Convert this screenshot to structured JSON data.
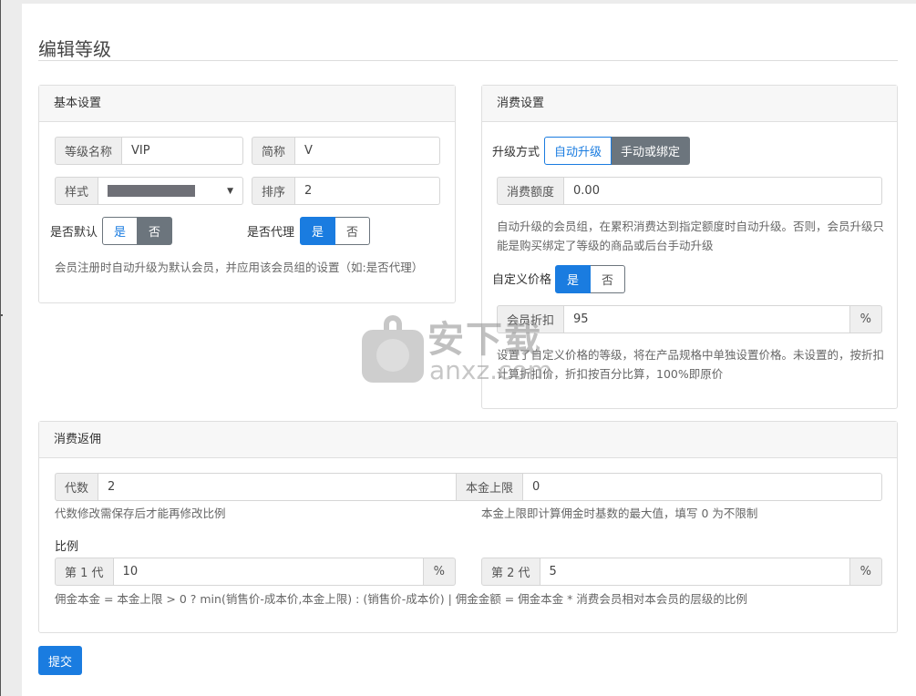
{
  "page": {
    "title": "编辑等级"
  },
  "basic": {
    "header": "基本设置",
    "level_name_label": "等级名称",
    "level_name_value": "VIP",
    "short_label": "简称",
    "short_value": "V",
    "style_label": "样式",
    "style_color": "#6f7077",
    "order_label": "排序",
    "order_value": "2",
    "default_label": "是否默认",
    "default_yes": "是",
    "default_no": "否",
    "default_selected": "否",
    "agent_label": "是否代理",
    "agent_yes": "是",
    "agent_no": "否",
    "agent_selected": "是",
    "help": "会员注册时自动升级为默认会员，并应用该会员组的设置（如:是否代理）"
  },
  "consume": {
    "header": "消费设置",
    "upgrade_label": "升级方式",
    "upgrade_auto": "自动升级",
    "upgrade_manual": "手动或绑定",
    "upgrade_selected": "手动或绑定",
    "amount_label": "消费额度",
    "amount_value": "0.00",
    "amount_help": "自动升级的会员组，在累积消费达到指定额度时自动升级。否则，会员升级只能是购买绑定了等级的商品或后台手动升级",
    "custom_price_label": "自定义价格",
    "custom_yes": "是",
    "custom_no": "否",
    "custom_selected": "是",
    "discount_label": "会员折扣",
    "discount_value": "95",
    "discount_suffix": "%",
    "discount_help": "设置了自定义价格的等级，将在产品规格中单独设置价格。未设置的，按折扣计算折扣价，折扣按百分比算，100%即原价"
  },
  "commission": {
    "header": "消费返佣",
    "gen_label": "代数",
    "gen_value": "2",
    "cap_label": "本金上限",
    "cap_value": "0",
    "gen_help": "代数修改需保存后才能再修改比例",
    "cap_help": "本金上限即计算佣金时基数的最大值，填写 0 为不限制",
    "ratio_label": "比例",
    "gen1_label": "第 1 代",
    "gen1_value": "10",
    "gen1_suffix": "%",
    "gen2_label": "第 2 代",
    "gen2_value": "5",
    "gen2_suffix": "%",
    "formula": "佣金本金 = 本金上限 > 0 ? min(销售价-成本价,本金上限) : (销售价-成本价)  |  佣金金额 = 佣金本金 * 消费会员相对本会员的层级的比例"
  },
  "submit_label": "提交",
  "watermark": {
    "text": "安下载",
    "domain": "anxz.com"
  },
  "colors": {
    "primary": "#1a7ce0",
    "secondary": "#6c757d"
  }
}
